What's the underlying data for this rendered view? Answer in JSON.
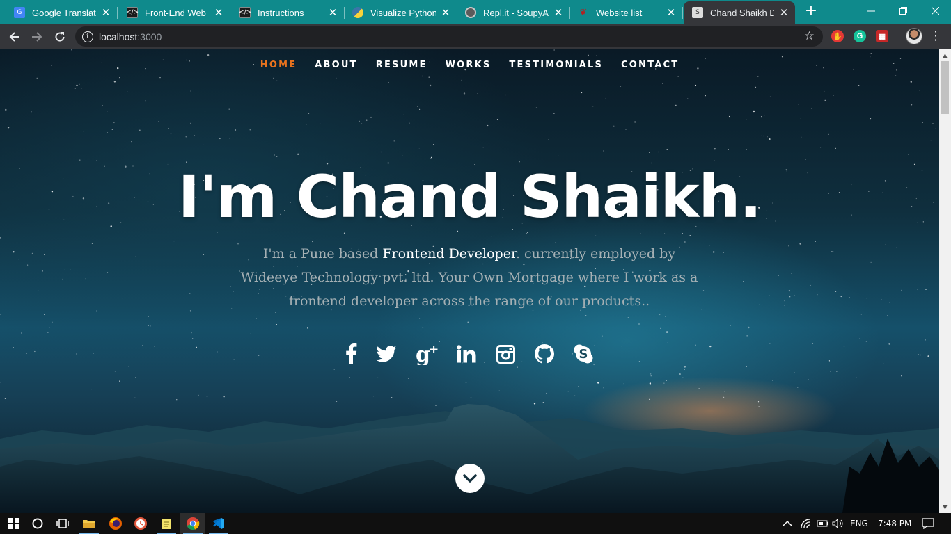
{
  "browser": {
    "tabs": [
      {
        "title": "Google Translate",
        "favicon": "google-translate-icon",
        "color": "#4285f4",
        "active": false
      },
      {
        "title": "Front-End Web De",
        "favicon": "code-icon",
        "color": "#1b1b1b",
        "active": false
      },
      {
        "title": "Instructions",
        "favicon": "code-icon",
        "color": "#1b1b1b",
        "active": false
      },
      {
        "title": "Visualize Python, J",
        "favicon": "python-icon",
        "color": "#3a75a8",
        "active": false
      },
      {
        "title": "Repl.it - SoupyAlpl",
        "favicon": "repl-icon",
        "color": "#5b5b5b",
        "active": false
      },
      {
        "title": "Website list",
        "favicon": "website-icon",
        "color": "#b22222",
        "active": false
      },
      {
        "title": "Chand Shaikh Dev",
        "favicon": "page-icon",
        "color": "#dddddd",
        "active": true
      }
    ],
    "new_tab": "+",
    "url_host": "localhost",
    "url_port": ":3000"
  },
  "page": {
    "nav": [
      {
        "label": "HOME",
        "current": true
      },
      {
        "label": "ABOUT",
        "current": false
      },
      {
        "label": "RESUME",
        "current": false
      },
      {
        "label": "WORKS",
        "current": false
      },
      {
        "label": "TESTIMONIALS",
        "current": false
      },
      {
        "label": "CONTACT",
        "current": false
      }
    ],
    "headline": "I'm Chand Shaikh.",
    "bio_prefix": "I'm a Pune based ",
    "bio_role": "Frontend Developer",
    "bio_suffix": ". currently employed by Wideeye Technology pvt. ltd. Your Own Mortgage where I work as a frontend developer across the range of our products..",
    "social": [
      "facebook-icon",
      "twitter-icon",
      "google-plus-icon",
      "linkedin-icon",
      "instagram-icon",
      "github-icon",
      "skype-icon"
    ],
    "accent_color": "#e8731e"
  },
  "taskbar": {
    "language": "ENG",
    "time": "7:48 PM"
  }
}
